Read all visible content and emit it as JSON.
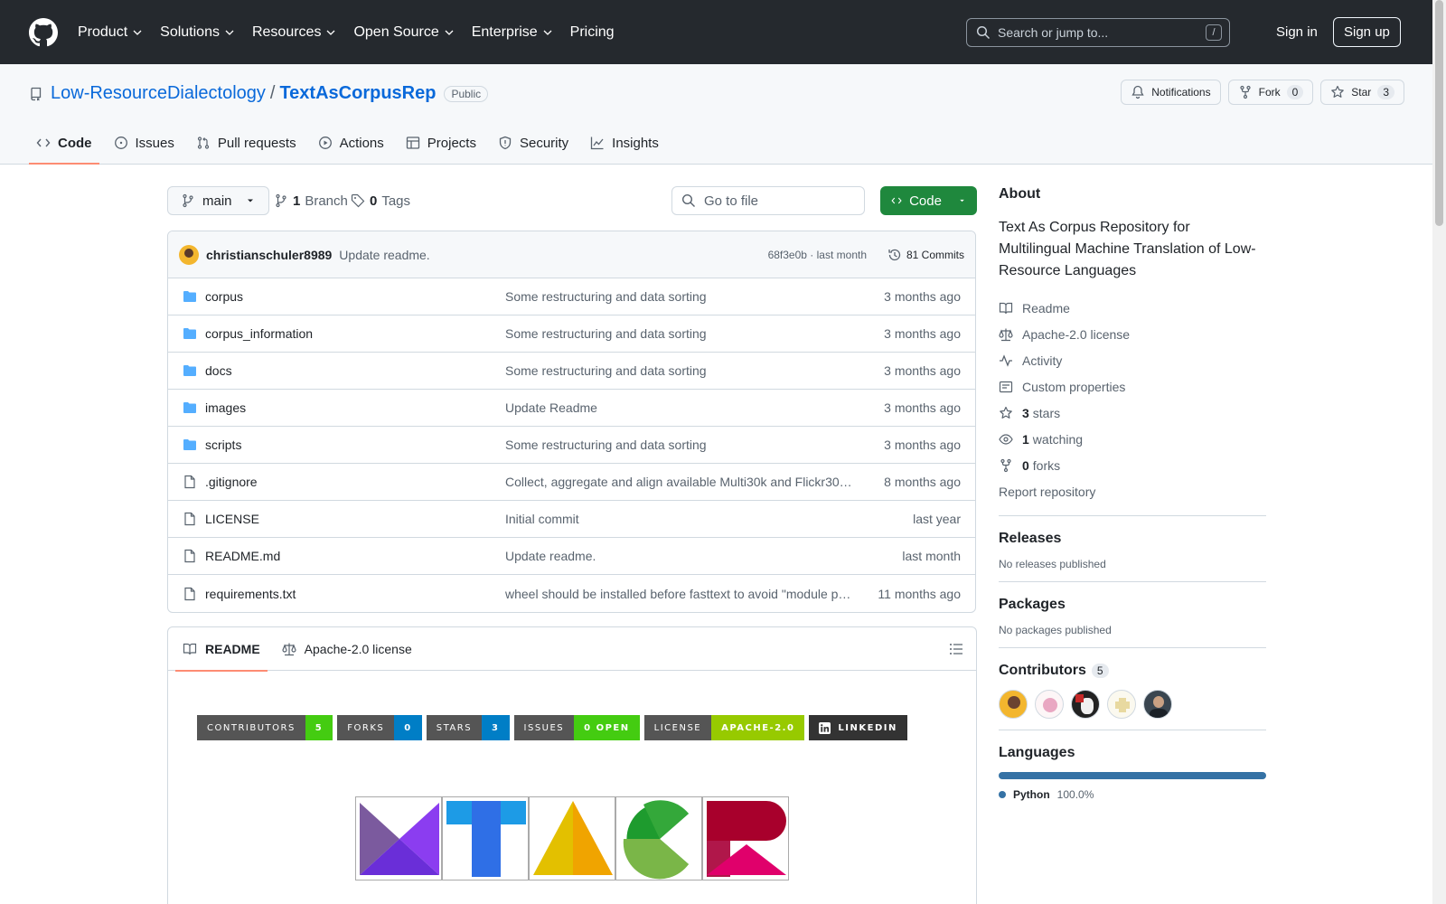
{
  "header": {
    "nav": [
      "Product",
      "Solutions",
      "Resources",
      "Open Source",
      "Enterprise",
      "Pricing"
    ],
    "search_placeholder": "Search or jump to...",
    "search_shortcut": "/",
    "sign_in": "Sign in",
    "sign_up": "Sign up"
  },
  "repo": {
    "owner": "Low-ResourceDialectology",
    "separator": "/",
    "name": "TextAsCorpusRep",
    "visibility": "Public",
    "notifications_label": "Notifications",
    "fork_label": "Fork",
    "fork_count": "0",
    "star_label": "Star",
    "star_count": "3",
    "tabs": [
      "Code",
      "Issues",
      "Pull requests",
      "Actions",
      "Projects",
      "Security",
      "Insights"
    ]
  },
  "toolbar": {
    "branch": "main",
    "branch_count": "1",
    "branch_label": "Branch",
    "tag_count": "0",
    "tag_label": "Tags",
    "goto_placeholder": "Go to file",
    "code_button": "Code"
  },
  "latest_commit": {
    "author": "christianschuler8989",
    "message": "Update readme.",
    "hash": "68f3e0b",
    "dot": "·",
    "time": "last month",
    "commits_label": "81 Commits"
  },
  "files": [
    {
      "name": "corpus",
      "type": "dir",
      "commit": "Some restructuring and data sorting",
      "age": "3 months ago"
    },
    {
      "name": "corpus_information",
      "type": "dir",
      "commit": "Some restructuring and data sorting",
      "age": "3 months ago"
    },
    {
      "name": "docs",
      "type": "dir",
      "commit": "Some restructuring and data sorting",
      "age": "3 months ago"
    },
    {
      "name": "images",
      "type": "dir",
      "commit": "Update Readme",
      "age": "3 months ago"
    },
    {
      "name": "scripts",
      "type": "dir",
      "commit": "Some restructuring and data sorting",
      "age": "3 months ago"
    },
    {
      "name": ".gitignore",
      "type": "file",
      "commit": "Collect, aggregate and align available Multi30k and Flickr30…",
      "age": "8 months ago"
    },
    {
      "name": "LICENSE",
      "type": "file",
      "commit": "Initial commit",
      "age": "last year"
    },
    {
      "name": "README.md",
      "type": "file",
      "commit": "Update readme.",
      "age": "last month"
    },
    {
      "name": "requirements.txt",
      "type": "file",
      "commit": "wheel should be installed before fasttext to avoid \"module p…",
      "age": "11 months ago"
    }
  ],
  "readme": {
    "tab_readme": "README",
    "tab_license": "Apache-2.0 license",
    "badges": [
      {
        "label": "CONTRIBUTORS",
        "value": "5",
        "color": "#4c1"
      },
      {
        "label": "FORKS",
        "value": "0",
        "color": "#007ec6"
      },
      {
        "label": "STARS",
        "value": "3",
        "color": "#007ec6"
      },
      {
        "label": "ISSUES",
        "value": "0 OPEN",
        "color": "#4c1"
      },
      {
        "label": "LICENSE",
        "value": "APACHE-2.0",
        "color": "#97ca00"
      }
    ],
    "linkedin_badge": "LINKEDIN"
  },
  "about": {
    "title": "About",
    "description": "Text As Corpus Repository for Multilingual Machine Translation of Low-Resource Languages",
    "readme": "Readme",
    "license": "Apache-2.0 license",
    "activity": "Activity",
    "custom_properties": "Custom properties",
    "stars_count": "3",
    "stars_label": "stars",
    "watching_count": "1",
    "watching_label": "watching",
    "forks_count": "0",
    "forks_label": "forks",
    "report": "Report repository"
  },
  "releases": {
    "title": "Releases",
    "note": "No releases published"
  },
  "packages": {
    "title": "Packages",
    "note": "No packages published"
  },
  "contributors": {
    "title": "Contributors",
    "count": "5"
  },
  "languages": {
    "title": "Languages",
    "name": "Python",
    "percent": "100.0%",
    "color": "#3572a5"
  }
}
